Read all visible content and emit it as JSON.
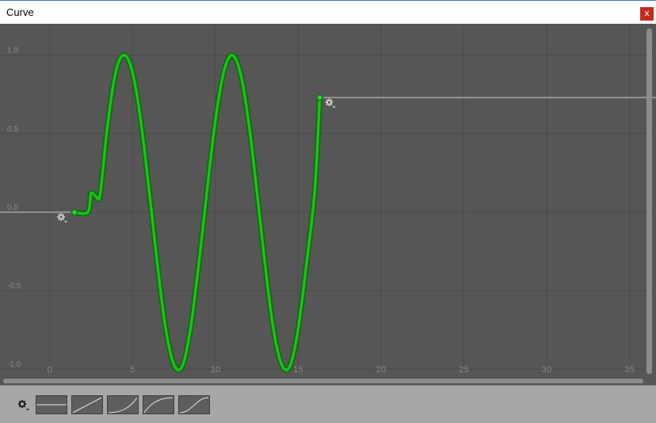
{
  "window": {
    "title": "Curve",
    "close_label": "x"
  },
  "colors": {
    "plot_background": "#565656",
    "grid": "#4a4a4a",
    "curve": "#1fbf1f",
    "curve_dark": "#0d6e0d",
    "wrap_line": "#cfcfcf",
    "preset_background": "#a7a7a7"
  },
  "icons": {
    "pre_wrap": "gear-icon",
    "post_wrap": "gear-icon",
    "presets_menu": "gear-icon"
  },
  "chart_data": {
    "type": "line",
    "title": "",
    "xlabel": "",
    "ylabel": "",
    "x_ticks": [
      "0",
      "5",
      "10",
      "15",
      "20",
      "25",
      "30",
      "35"
    ],
    "y_ticks": [
      "1.0",
      "0.5",
      "0.0",
      "-0.5",
      "-1.0"
    ],
    "xlim": [
      -3.0,
      36.6
    ],
    "ylim": [
      -1.1,
      1.2
    ],
    "grid": true,
    "series": [
      {
        "x": [
          1.5,
          2.3,
          2.5,
          2.8,
          3.05,
          3.5,
          4.0,
          4.5,
          5.0,
          5.5,
          6.0,
          6.5,
          7.0,
          7.5,
          8.0,
          8.5,
          9.0,
          9.5,
          10.0,
          10.5,
          11.0,
          11.5,
          12.0,
          12.5,
          13.0,
          13.5,
          14.0,
          14.5,
          15.0,
          15.5,
          16.0,
          16.3
        ],
        "y": [
          0.0,
          0.0,
          0.12,
          0.1,
          0.12,
          0.56,
          0.9,
          1.0,
          0.89,
          0.58,
          0.14,
          -0.33,
          -0.74,
          -0.97,
          -0.98,
          -0.74,
          -0.33,
          0.14,
          0.58,
          0.89,
          1.0,
          0.89,
          0.58,
          0.14,
          -0.33,
          -0.74,
          -0.97,
          -0.98,
          -0.74,
          -0.33,
          0.14,
          0.73
        ]
      }
    ],
    "pre_wrap": {
      "from_x": -3.0,
      "to_x": 1.5,
      "y": 0.0
    },
    "post_wrap": {
      "from_x": 16.3,
      "to_x": 36.6,
      "y": 0.73
    }
  },
  "presets": [
    "constant",
    "linear",
    "ease-in",
    "ease-out",
    "ease-in-out"
  ]
}
